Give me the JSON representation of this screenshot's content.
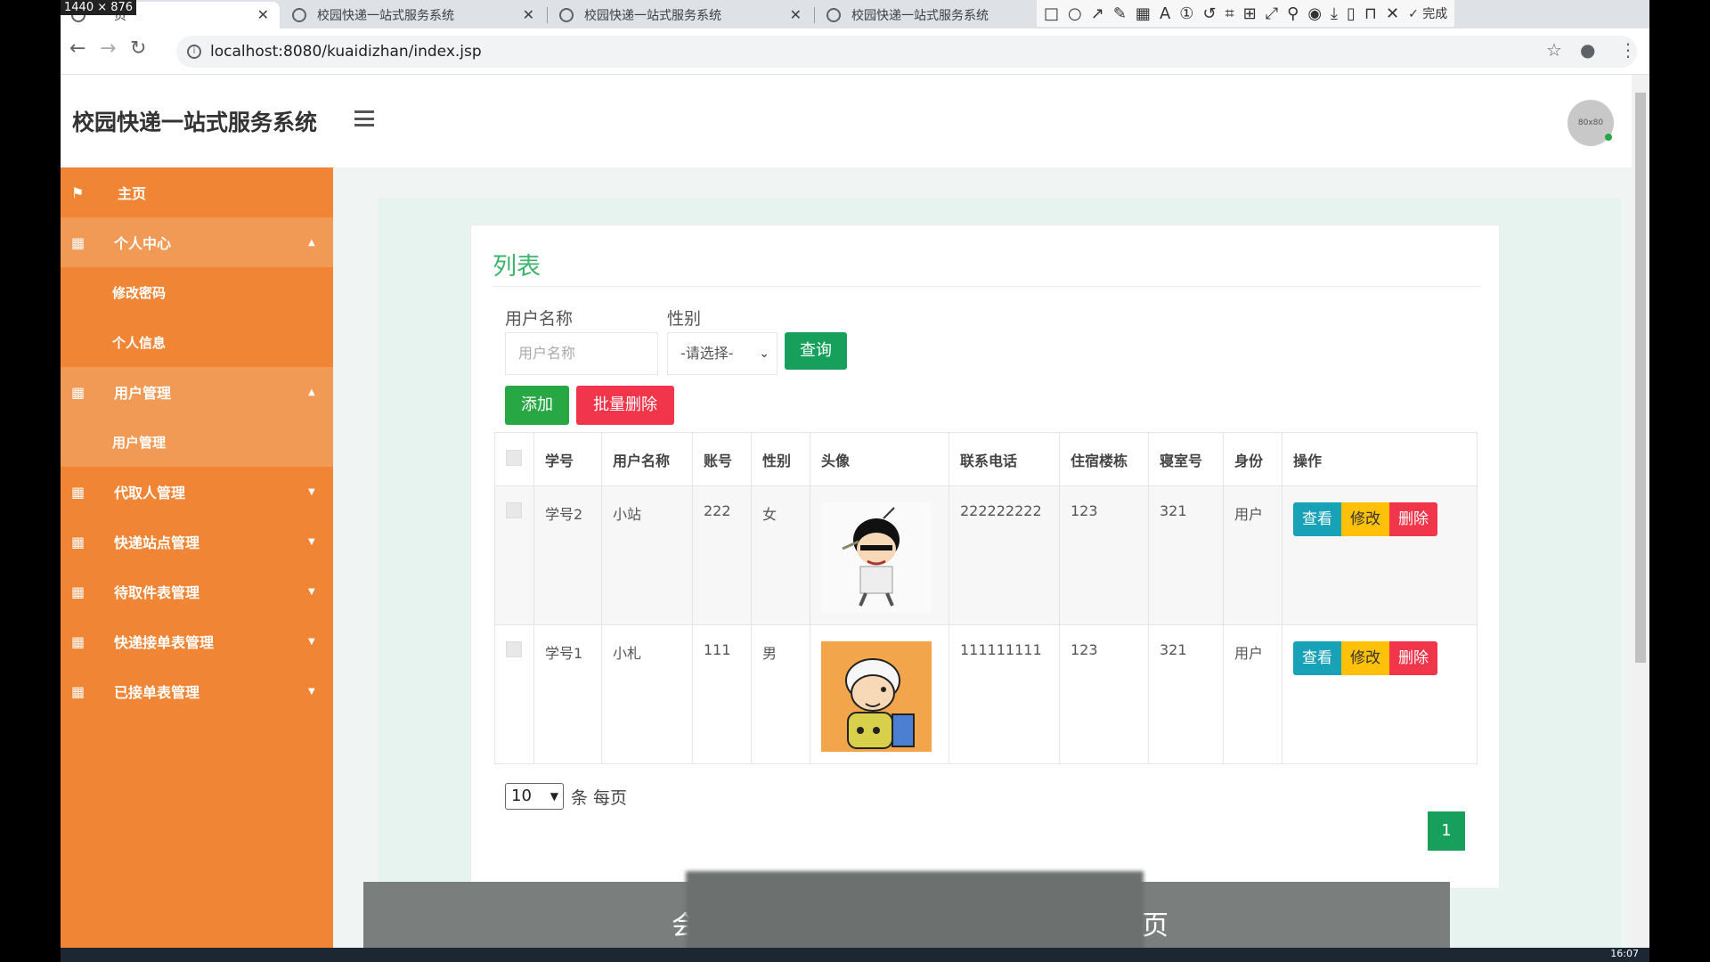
{
  "browser": {
    "resolution_badge": "1440 × 876",
    "tabs": [
      {
        "label": "页"
      },
      {
        "label": "校园快递一站式服务系统"
      },
      {
        "label": "校园快递一站式服务系统"
      },
      {
        "label": "校园快递一站式服务系统"
      }
    ],
    "url": "localhost:8080/kuaidizhan/index.jsp",
    "snip_done": "完成"
  },
  "header": {
    "title": "校园快递一站式服务系统",
    "avatar_text": "80x80"
  },
  "sidebar": {
    "items": [
      {
        "label": "主页"
      },
      {
        "label": "个人中心"
      },
      {
        "label": "修改密码"
      },
      {
        "label": "个人信息"
      },
      {
        "label": "用户管理"
      },
      {
        "label": "用户管理"
      },
      {
        "label": "代取人管理"
      },
      {
        "label": "快递站点管理"
      },
      {
        "label": "待取件表管理"
      },
      {
        "label": "快递接单表管理"
      },
      {
        "label": "已接单表管理"
      }
    ]
  },
  "main": {
    "title": "列表",
    "filter": {
      "username_label": "用户名称",
      "username_placeholder": "用户名称",
      "gender_label": "性别",
      "gender_selected": "-请选择-",
      "query_button": "查询"
    },
    "add_button": "添加",
    "batch_delete_button": "批量删除",
    "columns": [
      "学号",
      "用户名称",
      "账号",
      "性别",
      "头像",
      "联系电话",
      "住宿楼栋",
      "寝室号",
      "身份",
      "操作"
    ],
    "rows": [
      {
        "student_id": "学号2",
        "name": "小站",
        "account": "222",
        "gender": "女",
        "phone": "222222222",
        "building": "123",
        "room": "321",
        "role": "用户"
      },
      {
        "student_id": "学号1",
        "name": "小札",
        "account": "111",
        "gender": "男",
        "phone": "111111111",
        "building": "123",
        "room": "321",
        "role": "用户"
      }
    ],
    "actions": {
      "view": "查看",
      "edit": "修改",
      "delete": "删除"
    },
    "page_size": "10",
    "page_size_label": "条 每页",
    "current_page": "1"
  },
  "overlay": {
    "left_char": "会",
    "right_char": "页"
  },
  "taskbar": {
    "clock": "16:07"
  }
}
